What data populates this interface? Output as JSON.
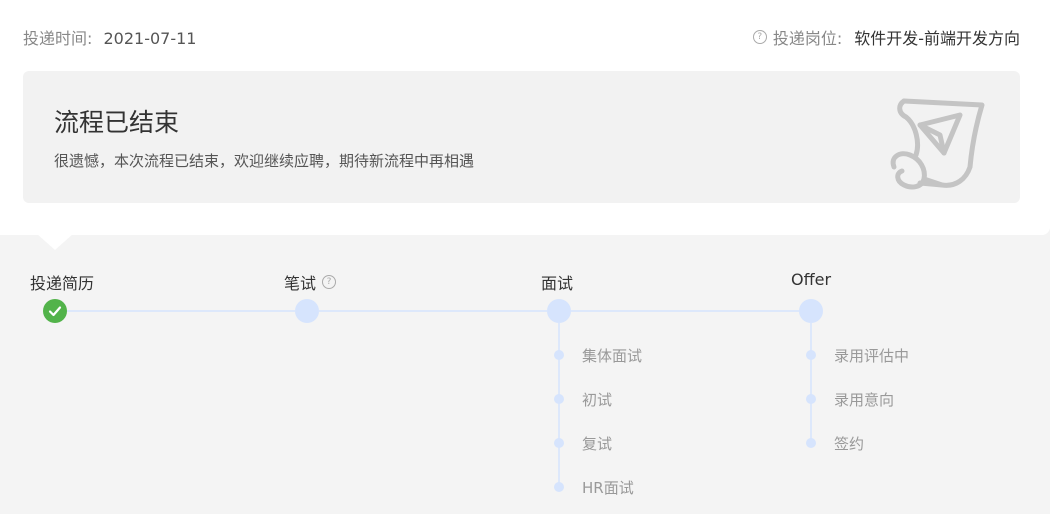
{
  "header": {
    "apply_time_label": "投递时间:",
    "apply_time_value": "2021-07-11",
    "position_label": "投递岗位:",
    "position_value": "软件开发-前端开发方向"
  },
  "status": {
    "title": "流程已结束",
    "description": "很遗憾，本次流程已结束，欢迎继续应聘，期待新流程中再相遇"
  },
  "stages": [
    {
      "label": "投递简历",
      "state": "done"
    },
    {
      "label": "笔试",
      "state": "pending",
      "has_help": true
    },
    {
      "label": "面试",
      "state": "pending",
      "substeps": [
        "集体面试",
        "初试",
        "复试",
        "HR面试"
      ]
    },
    {
      "label": "Offer",
      "state": "pending",
      "substeps": [
        "录用评估中",
        "录用意向",
        "签约"
      ]
    }
  ],
  "colors": {
    "done": "#52b34a",
    "pending_node": "#d6e4fd",
    "line": "#dde8fb"
  }
}
